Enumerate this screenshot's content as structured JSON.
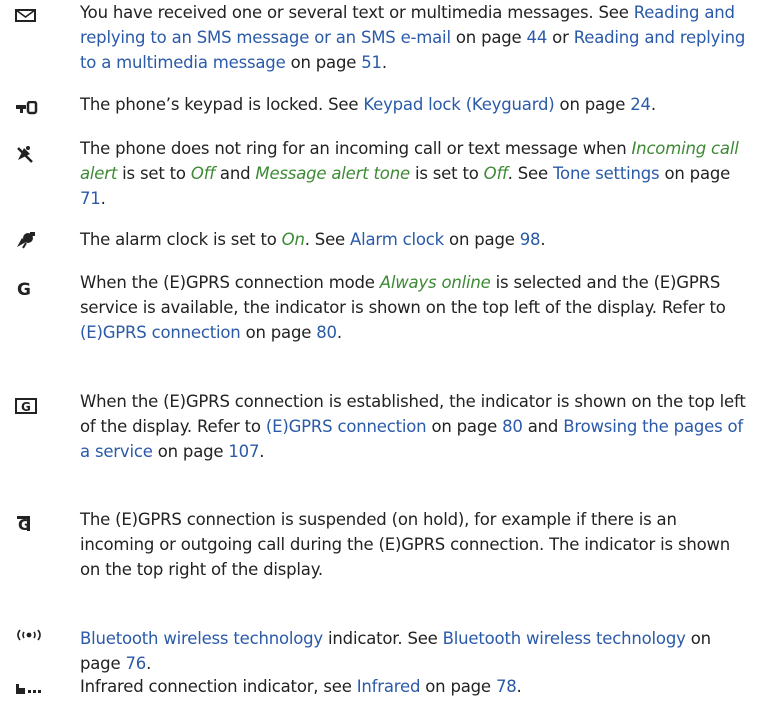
{
  "entries": [
    {
      "icon": "envelope-icon",
      "segments": [
        {
          "t": "You have received one or several text or multimedia messages. See ",
          "k": "n"
        },
        {
          "t": "Reading and replying to an SMS message or an SMS e-mail",
          "k": "l"
        },
        {
          "t": " on page ",
          "k": "n"
        },
        {
          "t": "44",
          "k": "l"
        },
        {
          "t": " or ",
          "k": "n"
        },
        {
          "t": "Reading and replying to a multimedia message",
          "k": "l"
        },
        {
          "t": " on page ",
          "k": "n"
        },
        {
          "t": "51",
          "k": "l"
        },
        {
          "t": ".",
          "k": "n"
        }
      ]
    },
    {
      "icon": "key-icon",
      "segments": [
        {
          "t": "The phone’s keypad is locked. See ",
          "k": "n"
        },
        {
          "t": "Keypad lock (Keyguard)",
          "k": "l"
        },
        {
          "t": " on page ",
          "k": "n"
        },
        {
          "t": "24",
          "k": "l"
        },
        {
          "t": ".",
          "k": "n"
        }
      ]
    },
    {
      "icon": "silent-bell-icon",
      "segments": [
        {
          "t": "The phone does not ring for an incoming call or text message when ",
          "k": "n"
        },
        {
          "t": "Incoming call alert",
          "k": "i"
        },
        {
          "t": " is set to ",
          "k": "n"
        },
        {
          "t": "Off",
          "k": "i"
        },
        {
          "t": " and ",
          "k": "n"
        },
        {
          "t": "Message alert tone",
          "k": "i"
        },
        {
          "t": " is set to ",
          "k": "n"
        },
        {
          "t": "Off",
          "k": "i"
        },
        {
          "t": ". See ",
          "k": "n"
        },
        {
          "t": "Tone settings",
          "k": "l"
        },
        {
          "t": " on page ",
          "k": "n"
        },
        {
          "t": "71",
          "k": "l"
        },
        {
          "t": ".",
          "k": "n"
        }
      ]
    },
    {
      "icon": "alarm-clock-icon",
      "segments": [
        {
          "t": "The alarm clock is set to ",
          "k": "n"
        },
        {
          "t": "On",
          "k": "i"
        },
        {
          "t": ". See ",
          "k": "n"
        },
        {
          "t": "Alarm clock",
          "k": "l"
        },
        {
          "t": " on page ",
          "k": "n"
        },
        {
          "t": "98",
          "k": "l"
        },
        {
          "t": ".",
          "k": "n"
        }
      ]
    },
    {
      "icon": "gprs-g-icon",
      "segments": [
        {
          "t": "When the (E)GPRS connection mode ",
          "k": "n"
        },
        {
          "t": "Always online",
          "k": "i"
        },
        {
          "t": " is selected and the (E)GPRS service is available, the indicator is shown on the top left of the display. Refer to ",
          "k": "n"
        },
        {
          "t": "(E)GPRS connection",
          "k": "l"
        },
        {
          "t": " on page ",
          "k": "n"
        },
        {
          "t": "80",
          "k": "l"
        },
        {
          "t": ".",
          "k": "n"
        }
      ]
    },
    {
      "icon": "gprs-connected-icon",
      "segments": [
        {
          "t": "When the (E)GPRS connection is established, the indicator is shown on the top left of the display. Refer to ",
          "k": "n"
        },
        {
          "t": "(E)GPRS connection",
          "k": "l"
        },
        {
          "t": " on page ",
          "k": "n"
        },
        {
          "t": "80",
          "k": "l"
        },
        {
          "t": " and ",
          "k": "n"
        },
        {
          "t": "Browsing the pages of a service",
          "k": "l"
        },
        {
          "t": " on page ",
          "k": "n"
        },
        {
          "t": "107",
          "k": "l"
        },
        {
          "t": ".",
          "k": "n"
        }
      ]
    },
    {
      "icon": "gprs-suspended-icon",
      "segments": [
        {
          "t": "The (E)GPRS connection is suspended (on hold), for example if there is an incoming or outgoing call during the (E)GPRS connection. The indicator is shown on the top right of the display.",
          "k": "n"
        }
      ]
    },
    {
      "icon": "bluetooth-indicator-icon",
      "segments": [
        {
          "t": "Bluetooth wireless technology",
          "k": "l"
        },
        {
          "t": " indicator. See ",
          "k": "n"
        },
        {
          "t": "Bluetooth wireless technology",
          "k": "l"
        },
        {
          "t": " on page ",
          "k": "n"
        },
        {
          "t": "76",
          "k": "l"
        },
        {
          "t": ".",
          "k": "n"
        }
      ]
    },
    {
      "icon": "infrared-indicator-icon",
      "segments": [
        {
          "t": "Infrared connection indicator, see ",
          "k": "n"
        },
        {
          "t": "Infrared",
          "k": "l"
        },
        {
          "t": " on page ",
          "k": "n"
        },
        {
          "t": "78",
          "k": "l"
        },
        {
          "t": ".",
          "k": "n"
        }
      ]
    }
  ],
  "colors": {
    "text": "#222222",
    "link": "#2a5aa8",
    "option": "#3d8a35"
  }
}
